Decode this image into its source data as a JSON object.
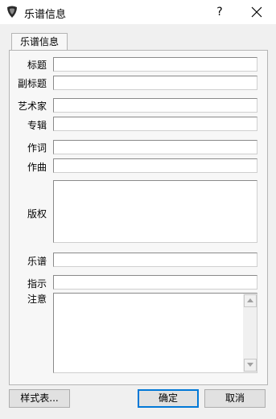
{
  "window": {
    "title": "乐谱信息",
    "help": "?"
  },
  "tabs": [
    {
      "label": "乐谱信息"
    }
  ],
  "fields": {
    "title": {
      "label": "标题",
      "value": ""
    },
    "subtitle": {
      "label": "副标题",
      "value": ""
    },
    "artist": {
      "label": "艺术家",
      "value": ""
    },
    "album": {
      "label": "专辑",
      "value": ""
    },
    "lyricist": {
      "label": "作词",
      "value": ""
    },
    "composer": {
      "label": "作曲",
      "value": ""
    },
    "copyright": {
      "label": "版权",
      "value": ""
    },
    "tab": {
      "label": "乐谱",
      "value": ""
    },
    "instructions": {
      "label": "指示",
      "value": ""
    },
    "notes": {
      "label": "注意",
      "value": ""
    }
  },
  "buttons": {
    "stylesheet": "样式表...",
    "ok": "确定",
    "cancel": "取消"
  },
  "icons": {
    "app": "guitar-pick-icon",
    "close": "close-icon",
    "scroll_up": "scroll-up-icon",
    "scroll_down": "scroll-down-icon"
  }
}
